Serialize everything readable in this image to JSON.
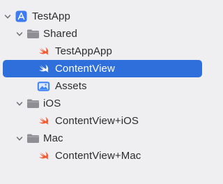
{
  "navigator": {
    "colors": {
      "selection": "#2f6fdc",
      "swift": "#f25a2e",
      "folder": "#8e8e93",
      "app": "#3d7cf0",
      "assets": "#3b82f6"
    },
    "items": [
      {
        "label": "TestApp",
        "icon": "xcode-project-icon",
        "type": "project",
        "expanded": true
      },
      {
        "label": "Shared",
        "icon": "folder-icon",
        "type": "group",
        "expanded": true
      },
      {
        "label": "TestAppApp",
        "icon": "swift-file-icon",
        "type": "file"
      },
      {
        "label": "ContentView",
        "icon": "swift-file-icon",
        "type": "file",
        "selected": true
      },
      {
        "label": "Assets",
        "icon": "asset-catalog-icon",
        "type": "file"
      },
      {
        "label": "iOS",
        "icon": "folder-icon",
        "type": "group",
        "expanded": true
      },
      {
        "label": "ContentView+iOS",
        "icon": "swift-file-icon",
        "type": "file"
      },
      {
        "label": "Mac",
        "icon": "folder-icon",
        "type": "group",
        "expanded": true
      },
      {
        "label": "ContentView+Mac",
        "icon": "swift-file-icon",
        "type": "file"
      }
    ]
  }
}
